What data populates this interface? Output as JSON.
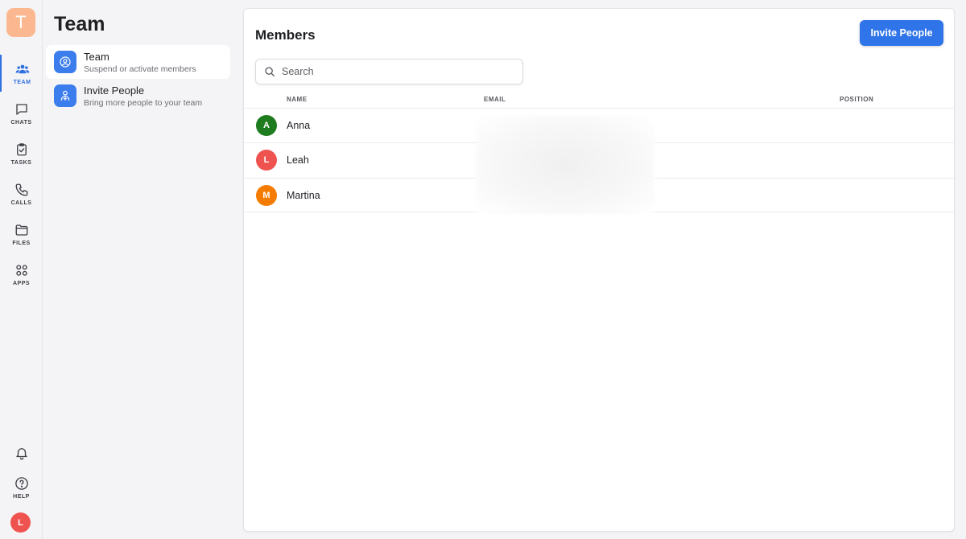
{
  "rail": {
    "workspace_initial": "T",
    "items": [
      {
        "label": "TEAM",
        "icon": "team-icon"
      },
      {
        "label": "CHATS",
        "icon": "chat-icon"
      },
      {
        "label": "TASKS",
        "icon": "tasks-icon"
      },
      {
        "label": "CALLS",
        "icon": "phone-icon"
      },
      {
        "label": "FILES",
        "icon": "folder-icon"
      },
      {
        "label": "APPS",
        "icon": "apps-icon"
      }
    ],
    "bottom": {
      "notifications_icon": "bell-icon",
      "help_label": "HELP",
      "user_initial": "L"
    }
  },
  "sidebar": {
    "title": "Team",
    "items": [
      {
        "label": "Team",
        "sub": "Suspend or activate members",
        "icon": "user-circle-icon"
      },
      {
        "label": "Invite People",
        "sub": "Bring more people to your team",
        "icon": "add-user-icon"
      }
    ]
  },
  "main": {
    "title": "Members",
    "invite_button": "Invite People",
    "search": {
      "placeholder": "Search",
      "value": ""
    },
    "columns": [
      "NAME",
      "EMAIL",
      "POSITION"
    ],
    "members": [
      {
        "initial": "A",
        "name": "Anna",
        "color": "#1e7b1e"
      },
      {
        "initial": "L",
        "name": "Leah",
        "color": "#ef5350"
      },
      {
        "initial": "M",
        "name": "Martina",
        "color": "#f57c00"
      }
    ]
  },
  "colors": {
    "accent": "#2f74e8",
    "workspace": "#fbb890"
  }
}
